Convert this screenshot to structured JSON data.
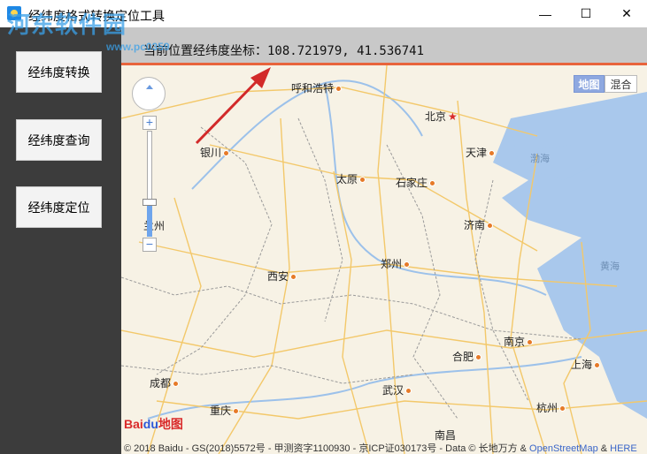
{
  "window": {
    "title": "经纬度格式转换定位工具",
    "min_glyph": "—",
    "max_glyph": "☐",
    "close_glyph": "✕"
  },
  "watermark": {
    "logo": "河东软件园",
    "url": "www.pc0359"
  },
  "sidebar": {
    "buttons": [
      {
        "label": "经纬度转换"
      },
      {
        "label": "经纬度查询"
      },
      {
        "label": "经纬度定位"
      }
    ]
  },
  "coordinates": {
    "text": "当前位置经纬度坐标：108.721979, 41.536741"
  },
  "map": {
    "nav_icon": "pan-control-icon",
    "zoom_in": "+",
    "zoom_out": "−",
    "zoom_level_fraction": 0.3,
    "map_type_active": "地图",
    "map_type_other": "混合",
    "cities": [
      "呼和浩特",
      "北京",
      "银川",
      "天津",
      "太原",
      "石家庄",
      "兰州",
      "济南",
      "西安",
      "郑州",
      "南京",
      "合肥",
      "上海",
      "成都",
      "武汉",
      "重庆",
      "杭州",
      "南昌"
    ],
    "seas": [
      "渤海",
      "黄海"
    ],
    "logo": {
      "text": "Bai",
      "paw": "du",
      "tail": "地图"
    },
    "copyright": {
      "main": "© 2018 Baidu - GS(2018)5572号 - 甲测资字1100930 - 京ICP证030173号 - Data © 长地万方 & ",
      "osm": "OpenStreetMap",
      "amp": " & ",
      "here": "HERE"
    }
  },
  "colors": {
    "sidebar": "#3c3c3c",
    "coord_bar": "#c8c8c8",
    "accent_line": "#e8643c",
    "arrow": "#d22a2a",
    "map_land": "#f7f2e5",
    "map_sea": "#a9c8ec"
  }
}
